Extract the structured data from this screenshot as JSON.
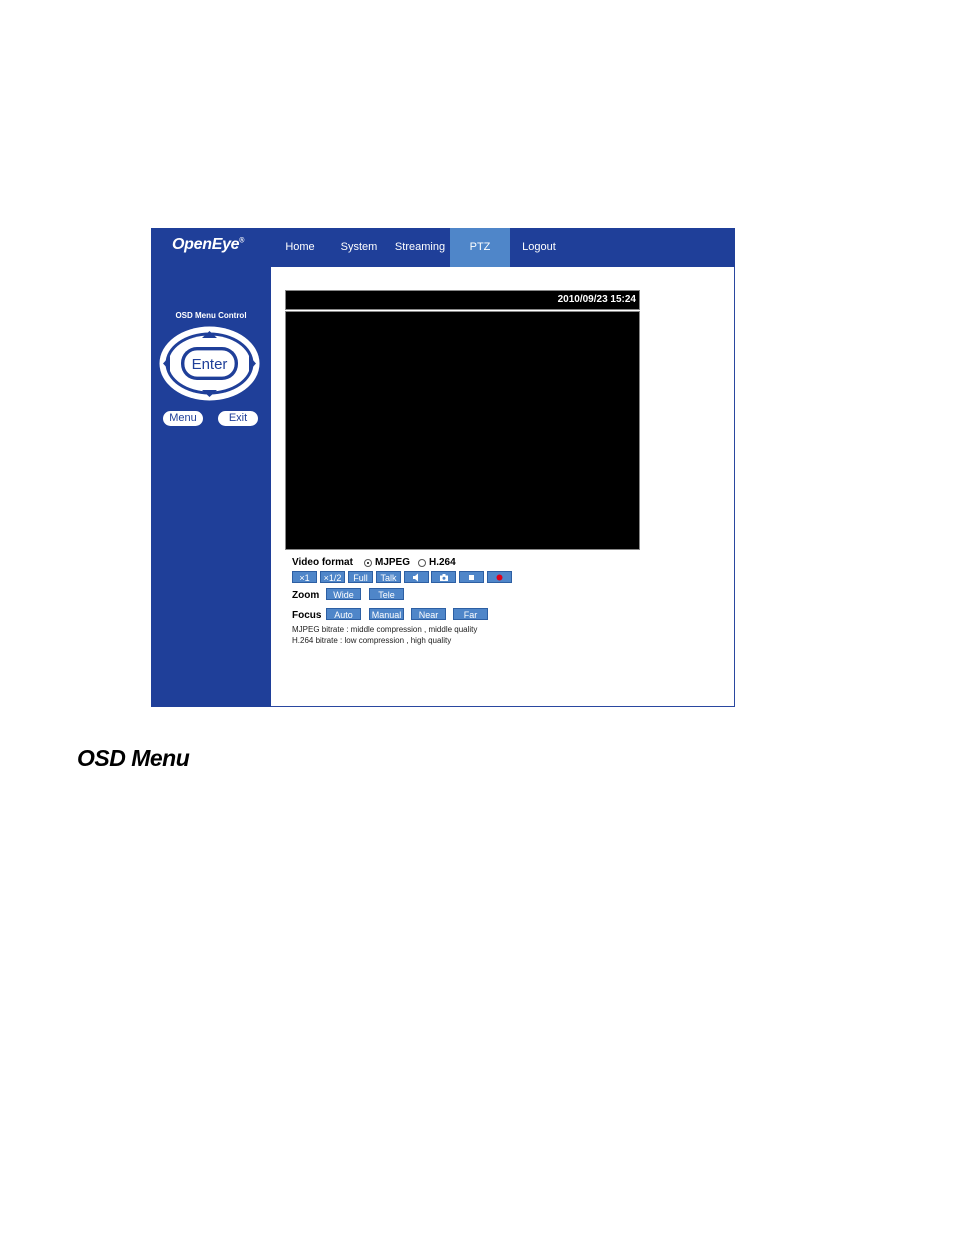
{
  "app": {
    "logo": "OpenEye"
  },
  "nav": {
    "items": [
      "Home",
      "System",
      "Streaming",
      "PTZ",
      "Logout"
    ],
    "active": "PTZ"
  },
  "osd": {
    "title": "OSD Menu Control",
    "enter": "Enter",
    "menu": "Menu",
    "exit": "Exit"
  },
  "video": {
    "timestamp": "2010/09/23 15:24"
  },
  "format": {
    "label": "Video format",
    "options": [
      "MJPEG",
      "H.264"
    ],
    "selected": "MJPEG"
  },
  "view_buttons": [
    "×1",
    "×1/2",
    "Full",
    "Talk"
  ],
  "icon_buttons": [
    "speaker-icon",
    "camera-icon",
    "stop-icon",
    "record-icon"
  ],
  "zoom": {
    "label": "Zoom",
    "wide": "Wide",
    "tele": "Tele"
  },
  "focus": {
    "label": "Focus",
    "auto": "Auto",
    "manual": "Manual",
    "near": "Near",
    "far": "Far"
  },
  "bitrate": {
    "mjpeg": "MJPEG bitrate : middle compression , middle quality",
    "h264": "H.264 bitrate : low compression , high quality"
  },
  "section_heading": "OSD Menu",
  "colors": {
    "navy": "#1f3f99",
    "active_tab": "#4f86c9",
    "button": "#4f86c9",
    "record": "#e0001a"
  }
}
